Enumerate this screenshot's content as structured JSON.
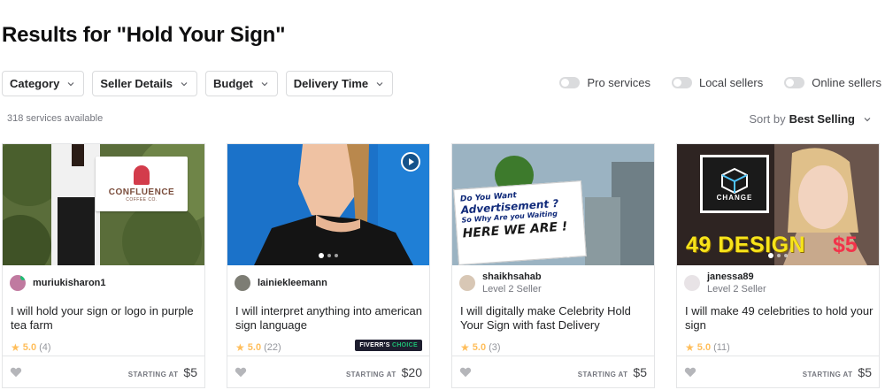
{
  "page": {
    "title": "Results for \"Hold Your Sign\""
  },
  "filters": [
    {
      "label": "Category"
    },
    {
      "label": "Seller Details"
    },
    {
      "label": "Budget"
    },
    {
      "label": "Delivery Time"
    }
  ],
  "toggles": [
    {
      "label": "Pro services",
      "on": false
    },
    {
      "label": "Local sellers",
      "on": false
    },
    {
      "label": "Online sellers",
      "on": false
    }
  ],
  "results": {
    "count_text": "318 services available"
  },
  "sort": {
    "prefix": "Sort by",
    "value": "Best Selling"
  },
  "cards": [
    {
      "seller": "muriukisharon1",
      "level": "",
      "title": "I will hold your sign or logo in purple tea farm",
      "rating": "5.0",
      "reviews": "(4)",
      "starting_label": "STARTING AT",
      "price": "$5",
      "thumb_text": "CONFLUENCE",
      "thumb_subtext": "COFFEE CO."
    },
    {
      "seller": "lainiekleemann",
      "level": "",
      "title": "I will interpret anything into american sign language",
      "rating": "5.0",
      "reviews": "(22)",
      "badge_prefix": "FIVERR'S",
      "badge_suffix": "CHOICE",
      "starting_label": "STARTING AT",
      "price": "$20"
    },
    {
      "seller": "shaikhsahab",
      "level": "Level 2 Seller",
      "title": "I will digitally make Celebrity Hold Your Sign with fast Delivery",
      "rating": "5.0",
      "reviews": "(3)",
      "starting_label": "STARTING AT",
      "price": "$5",
      "sign_lines": [
        "Do You Want",
        "Advertisement ?",
        "So Why Are you Waiting",
        "HERE WE ARE !"
      ]
    },
    {
      "seller": "janessa89",
      "level": "Level 2 Seller",
      "title": "I will make 49 celebrities to hold your sign",
      "rating": "5.0",
      "reviews": "(11)",
      "starting_label": "STARTING AT",
      "price": "$5",
      "thumb_text": "49 DESIGN",
      "thumb_price": "$5",
      "sign_text": "CHANGE"
    }
  ],
  "colors": {
    "star": "#ffbe5b",
    "badge_bg": "#1e1e2f",
    "badge_accent": "#1dbf73"
  }
}
